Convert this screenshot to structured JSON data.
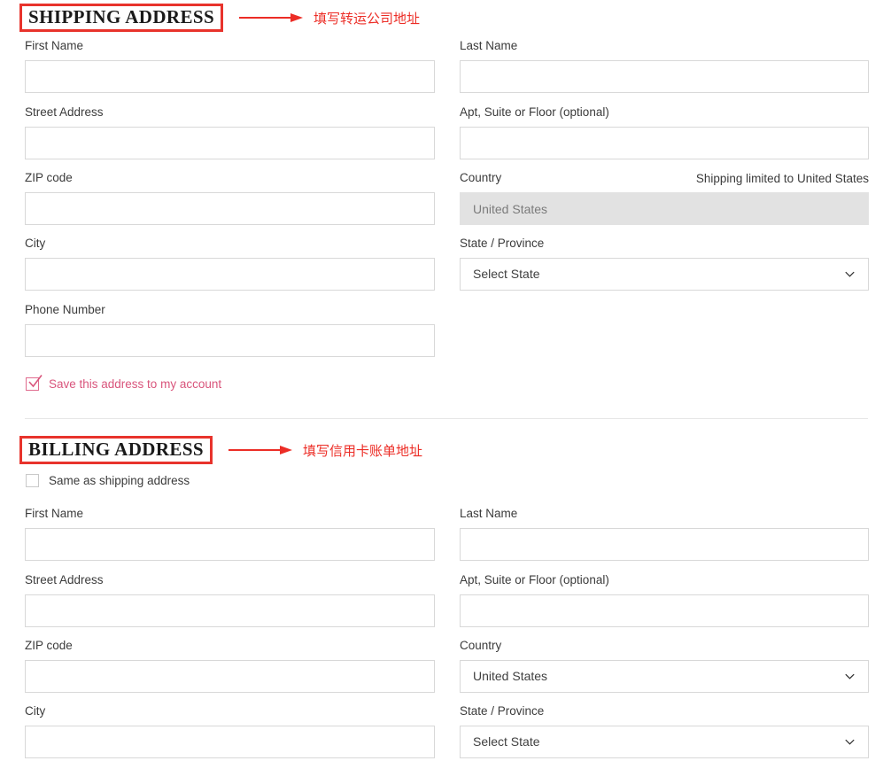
{
  "colors": {
    "annotation_red": "#ec2d26",
    "title_border_red": "#e8332c",
    "accent_pink": "#d9557c",
    "input_border": "#d8d8d8",
    "disabled_bg": "#e2e2e2",
    "label_text": "#3b3b3b",
    "divider": "#e6e6e6"
  },
  "shipping": {
    "title": "SHIPPING ADDRESS",
    "annotation": "填写转运公司地址",
    "fields": {
      "first_name_label": "First Name",
      "first_name_value": "",
      "last_name_label": "Last Name",
      "last_name_value": "",
      "street_label": "Street Address",
      "street_value": "",
      "apt_label": "Apt, Suite or Floor (optional)",
      "apt_value": "",
      "zip_label": "ZIP code",
      "zip_value": "",
      "country_label": "Country",
      "country_hint": "Shipping limited to United States",
      "country_value": "United States",
      "city_label": "City",
      "city_value": "",
      "state_label": "State / Province",
      "state_value": "Select State",
      "phone_label": "Phone Number",
      "phone_value": ""
    },
    "save_checkbox": {
      "label": "Save this address to my account",
      "checked": true
    }
  },
  "billing": {
    "title": "BILLING ADDRESS",
    "annotation": "填写信用卡账单地址",
    "same_as_shipping": {
      "label": "Same as shipping address",
      "checked": false
    },
    "fields": {
      "first_name_label": "First Name",
      "first_name_value": "",
      "last_name_label": "Last Name",
      "last_name_value": "",
      "street_label": "Street Address",
      "street_value": "",
      "apt_label": "Apt, Suite or Floor (optional)",
      "apt_value": "",
      "zip_label": "ZIP code",
      "zip_value": "",
      "country_label": "Country",
      "country_value": "United States",
      "city_label": "City",
      "city_value": "",
      "state_label": "State / Province",
      "state_value": "Select State"
    }
  },
  "icons": {
    "chevron_down": "chevron-down-icon",
    "arrow_right": "arrow-right-icon",
    "check": "check-icon"
  }
}
